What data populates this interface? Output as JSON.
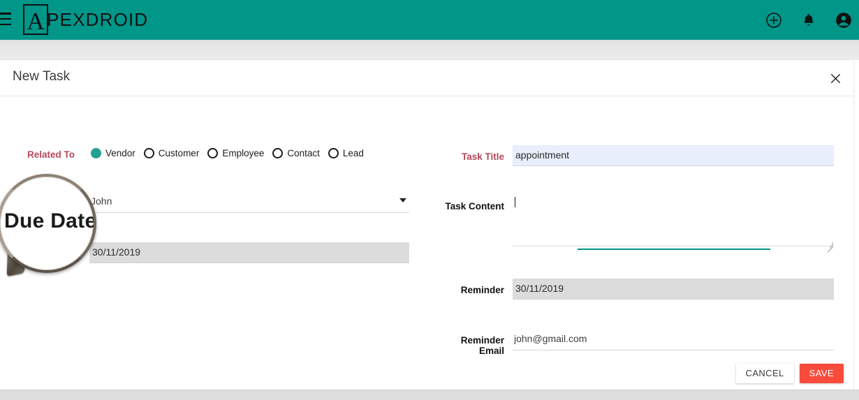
{
  "appbar": {
    "menu_icon": "hamburger-menu-icon",
    "logo_initial": "A",
    "logo_text": "PEXDROID",
    "actions": [
      {
        "name": "add-circle-icon",
        "label": "Add"
      },
      {
        "name": "notifications-bell-icon",
        "label": "Notifications"
      },
      {
        "name": "account-circle-icon",
        "label": "Account"
      }
    ],
    "background_color": "#009688"
  },
  "dialog": {
    "title": "New Task",
    "close_label": "×"
  },
  "form": {
    "related_to": {
      "label": "Related To",
      "options": [
        "Vendor",
        "Customer",
        "Employee",
        "Contact",
        "Lead"
      ],
      "selected": "Vendor"
    },
    "vendor": {
      "label": "Vendor",
      "value": "John",
      "placeholder": ""
    },
    "due_date": {
      "label": "Due Date",
      "value": "30/11/2019",
      "placeholder": ""
    },
    "task_title": {
      "label": "Task Title",
      "value": "appointment",
      "placeholder": ""
    },
    "task_content": {
      "label": "Task Content",
      "value": "",
      "placeholder": ""
    },
    "reminder": {
      "label": "Reminder",
      "value": "30/11/2019",
      "placeholder": ""
    },
    "reminder_email": {
      "label_line1": "Reminder",
      "label_line2": "Email",
      "value": "john@gmail.com",
      "placeholder": ""
    }
  },
  "footer": {
    "cancel_label": "CANCEL",
    "save_label": "SAVE",
    "save_color": "#f84b3c"
  },
  "magnifier": {
    "magnified_text": "Due Date"
  }
}
